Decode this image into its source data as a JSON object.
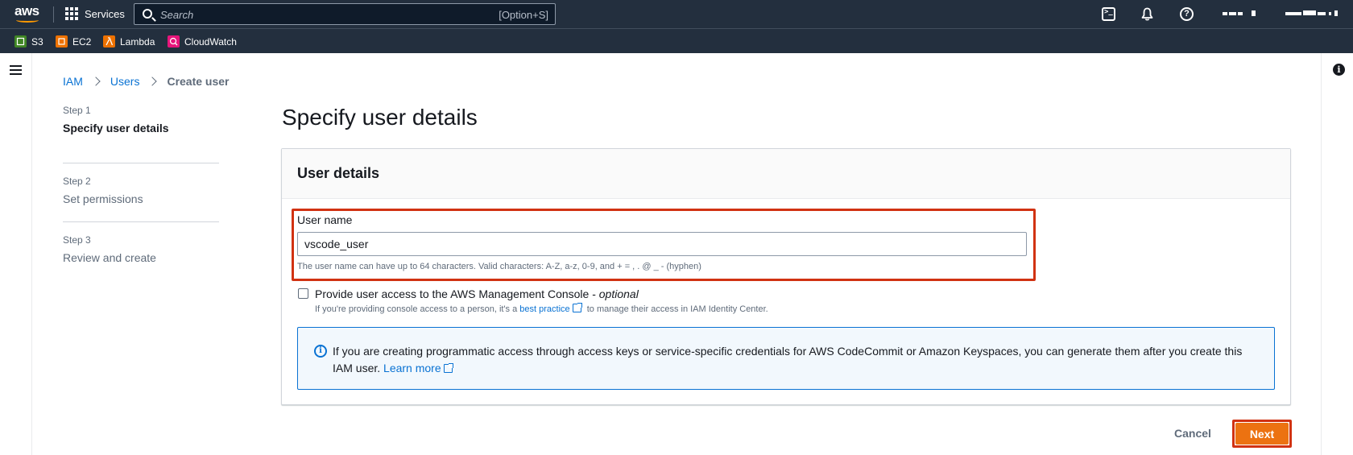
{
  "topnav": {
    "logo_text": "aws",
    "services_label": "Services",
    "search_placeholder": "Search",
    "search_shortcut": "[Option+S]"
  },
  "favorites": [
    {
      "label": "S3",
      "color": "#3f8624"
    },
    {
      "label": "EC2",
      "color": "#ed7100"
    },
    {
      "label": "Lambda",
      "color": "#ed7100"
    },
    {
      "label": "CloudWatch",
      "color": "#e7157b"
    }
  ],
  "breadcrumb": {
    "items": [
      "IAM",
      "Users"
    ],
    "current": "Create user"
  },
  "steps": [
    {
      "num": "Step 1",
      "title": "Specify user details"
    },
    {
      "num": "Step 2",
      "title": "Set permissions"
    },
    {
      "num": "Step 3",
      "title": "Review and create"
    }
  ],
  "main": {
    "page_title": "Specify user details",
    "panel_title": "User details",
    "user_name_label": "User name",
    "user_name_value": "vscode_user",
    "user_name_hint": "The user name can have up to 64 characters. Valid characters: A-Z, a-z, 0-9, and + = , . @ _ - (hyphen)",
    "console_access_label": "Provide user access to the AWS Management Console - ",
    "console_access_optional": "optional",
    "console_desc_before": "If you're providing console access to a person, it's a ",
    "console_desc_link": "best practice",
    "console_desc_after": " to manage their access in IAM Identity Center.",
    "alert_text": "If you are creating programmatic access through access keys or service-specific credentials for AWS CodeCommit or Amazon Keyspaces, you can generate them after you create this IAM user. ",
    "alert_link": "Learn more"
  },
  "footer": {
    "cancel_label": "Cancel",
    "next_label": "Next"
  },
  "colors": {
    "nav_bg": "#232f3e",
    "link": "#0972d3",
    "primary_button": "#ec7211",
    "highlight_outline": "#d13212"
  }
}
